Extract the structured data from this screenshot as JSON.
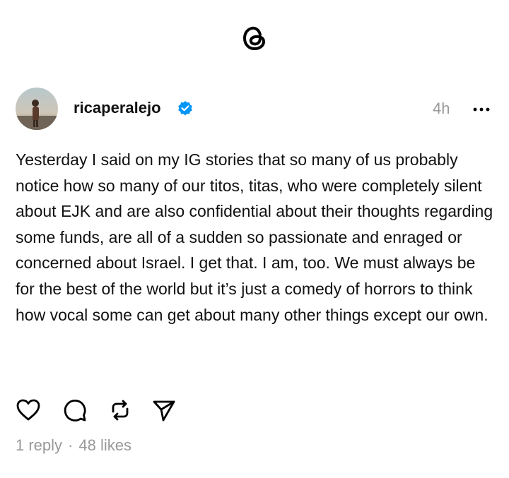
{
  "post": {
    "username": "ricaperalejo",
    "time": "4h",
    "text": "Yesterday I said on my IG stories that so many of us probably notice how so many of our titos, titas, who were completely silent about EJK and are also confidential about their thoughts regarding some funds, are all of a sudden so passionate and enraged or concerned about Israel. I get that. I am, too. We must always be for the best of the world but it’s just a comedy of horrors to think how vocal some can get about many other things except our own.",
    "replies": "1 reply",
    "separator": "·",
    "likes": "48 likes"
  },
  "icons": {
    "logo": "threads-logo-icon",
    "verified": "verified-badge-icon",
    "more": "more-icon",
    "like": "heart-icon",
    "reply": "comment-icon",
    "repost": "repost-icon",
    "share": "share-icon"
  },
  "colors": {
    "verified": "#0095f6",
    "muted": "#999999"
  }
}
